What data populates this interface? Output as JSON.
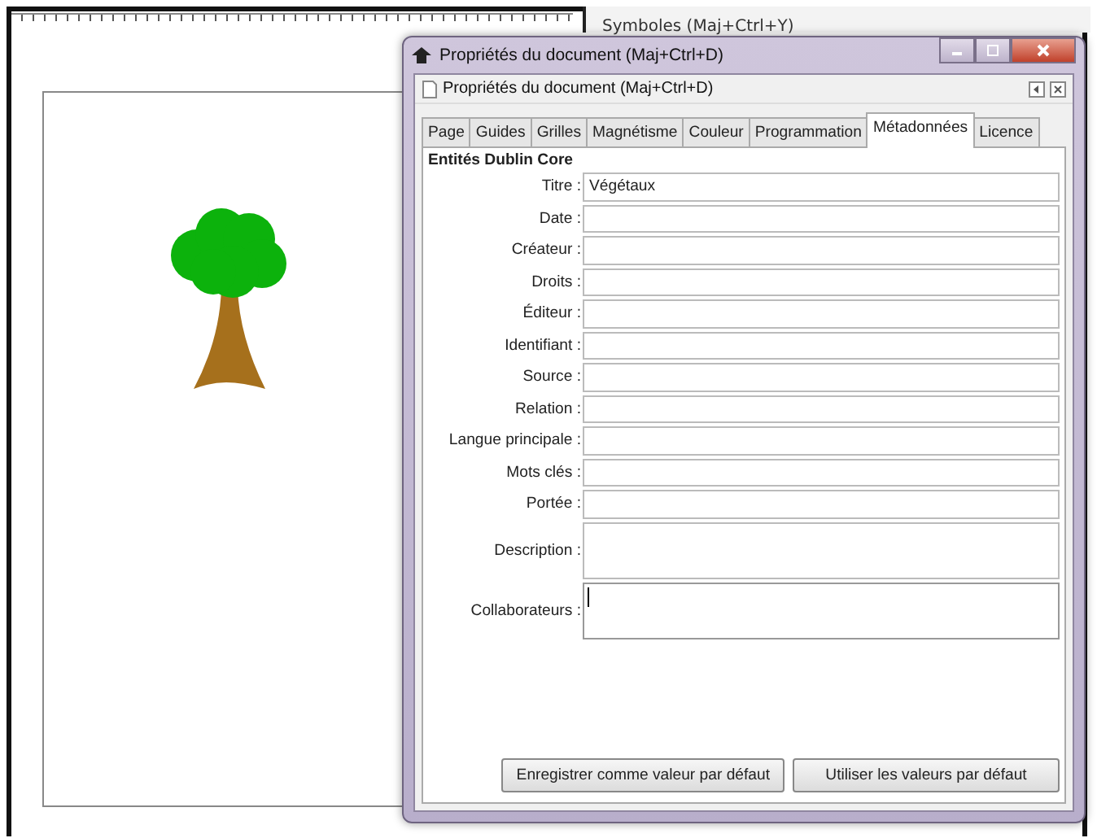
{
  "symbols_panel": {
    "title": "Symboles (Maj+Ctrl+Y)"
  },
  "dialog": {
    "title": "Propriétés du document (Maj+Ctrl+D)",
    "panel_title": "Propriétés du document (Maj+Ctrl+D)",
    "tabs": [
      {
        "label": "Page",
        "selected": false
      },
      {
        "label": "Guides",
        "selected": false
      },
      {
        "label": "Grilles",
        "selected": false
      },
      {
        "label": "Magnétisme",
        "selected": false
      },
      {
        "label": "Couleur",
        "selected": false
      },
      {
        "label": "Programmation",
        "selected": false
      },
      {
        "label": "Métadonnées",
        "selected": true
      },
      {
        "label": "Licence",
        "selected": false
      }
    ],
    "section_title": "Entités Dublin Core",
    "fields": [
      {
        "label": "Titre :",
        "kind": "line",
        "value": "Végétaux",
        "focused": false
      },
      {
        "label": "Date :",
        "kind": "line",
        "focused": false
      },
      {
        "label": "Créateur :",
        "kind": "line",
        "focused": false
      },
      {
        "label": "Droits :",
        "kind": "line",
        "focused": false
      },
      {
        "label": "Éditeur :",
        "kind": "line",
        "focused": false
      },
      {
        "label": "Identifiant :",
        "kind": "line",
        "focused": false
      },
      {
        "label": "Source :",
        "kind": "line",
        "focused": false
      },
      {
        "label": "Relation :",
        "kind": "line",
        "focused": false
      },
      {
        "label": "Langue principale :",
        "kind": "line",
        "focused": false
      },
      {
        "label": "Mots clés :",
        "kind": "line",
        "focused": false
      },
      {
        "label": "Portée :",
        "kind": "line",
        "focused": false
      },
      {
        "label": "Description :",
        "kind": "multi",
        "focused": false
      },
      {
        "label": "Collaborateurs :",
        "kind": "multi",
        "focused": true
      }
    ],
    "buttons": [
      "Enregistrer comme valeur par défaut",
      "Utiliser les valeurs par défaut"
    ]
  }
}
